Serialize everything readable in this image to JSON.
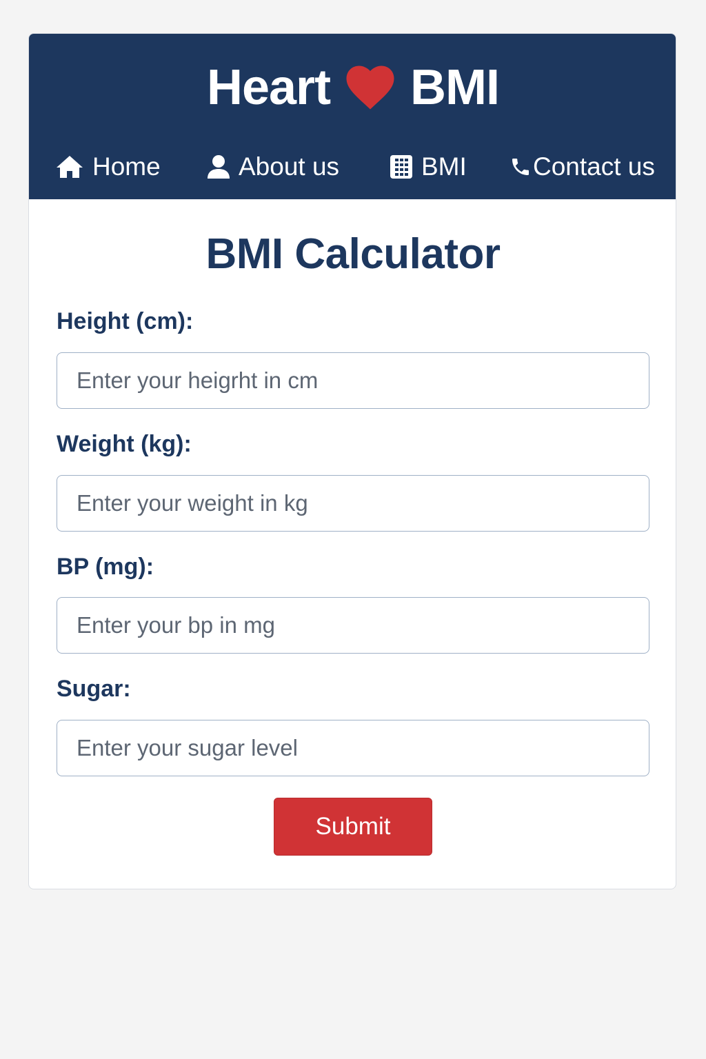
{
  "brand": {
    "text_left": "Heart",
    "text_right": "BMI",
    "heart_color": "#d03335",
    "icon": "heart-icon"
  },
  "nav": {
    "items": [
      {
        "label": "Home",
        "icon": "home-icon"
      },
      {
        "label": "About us",
        "icon": "user-icon"
      },
      {
        "label": "BMI",
        "icon": "calculator-icon"
      },
      {
        "label": "Contact us",
        "icon": "phone-icon"
      }
    ]
  },
  "form": {
    "title": "BMI Calculator",
    "fields": [
      {
        "label": "Height (cm):",
        "placeholder": "Enter your heigrht in cm",
        "value": ""
      },
      {
        "label": "Weight (kg):",
        "placeholder": "Enter your weight in kg",
        "value": ""
      },
      {
        "label": "BP (mg):",
        "placeholder": "Enter your bp in mg",
        "value": ""
      },
      {
        "label": "Sugar:",
        "placeholder": "Enter your sugar level",
        "value": ""
      }
    ],
    "submit_label": "Submit"
  },
  "colors": {
    "header_bg": "#1d375e",
    "accent_red": "#d03335",
    "page_bg": "#f4f4f4"
  }
}
